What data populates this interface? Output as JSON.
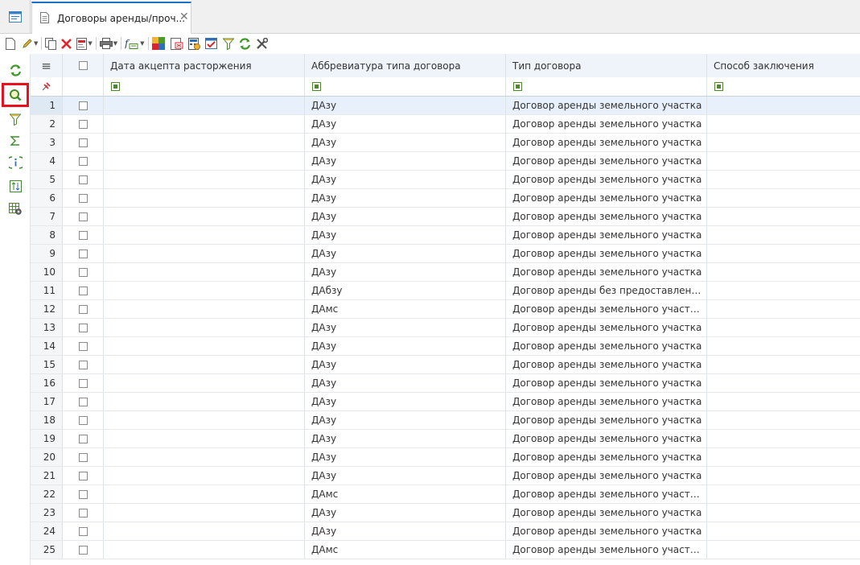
{
  "tab": {
    "title": "Договоры аренды/проч...",
    "close": "✕"
  },
  "toolbar": {
    "icons": [
      "new-document-icon",
      "edit-pencil-icon",
      "copy-icon",
      "delete-icon",
      "report-icon",
      "print-icon",
      "formula-icon",
      "transfer-icon",
      "export-icon",
      "calculator-icon",
      "checklist-icon",
      "filter-icon",
      "refresh-icon",
      "tools-icon"
    ]
  },
  "left_toolbar": {
    "items": [
      "refresh-icon",
      "search-icon",
      "filter-icon",
      "sum-icon",
      "info-icon",
      "sort-icon",
      "grid-settings-icon"
    ],
    "selected": "search-icon"
  },
  "grid": {
    "columns": [
      {
        "label": "Дата акцепта расторжения"
      },
      {
        "label": "Аббревиатура типа договора"
      },
      {
        "label": "Тип договора"
      },
      {
        "label": "Способ заключения"
      }
    ],
    "menu_glyph": "≡",
    "rows": [
      {
        "n": "1",
        "abbr": "ДАзу",
        "type": "Договор аренды земельного участка"
      },
      {
        "n": "2",
        "abbr": "ДАзу",
        "type": "Договор аренды земельного участка"
      },
      {
        "n": "3",
        "abbr": "ДАзу",
        "type": "Договор аренды земельного участка"
      },
      {
        "n": "4",
        "abbr": "ДАзу",
        "type": "Договор аренды земельного участка"
      },
      {
        "n": "5",
        "abbr": "ДАзу",
        "type": "Договор аренды земельного участка"
      },
      {
        "n": "6",
        "abbr": "ДАзу",
        "type": "Договор аренды земельного участка"
      },
      {
        "n": "7",
        "abbr": "ДАзу",
        "type": "Договор аренды земельного участка"
      },
      {
        "n": "8",
        "abbr": "ДАзу",
        "type": "Договор аренды земельного участка"
      },
      {
        "n": "9",
        "abbr": "ДАзу",
        "type": "Договор аренды земельного участка"
      },
      {
        "n": "10",
        "abbr": "ДАзу",
        "type": "Договор аренды земельного участка"
      },
      {
        "n": "11",
        "abbr": "ДАбзу",
        "type": "Договор аренды без предоставлени..."
      },
      {
        "n": "12",
        "abbr": "ДАмс",
        "type": "Договор аренды земельного участк..."
      },
      {
        "n": "13",
        "abbr": "ДАзу",
        "type": "Договор аренды земельного участка"
      },
      {
        "n": "14",
        "abbr": "ДАзу",
        "type": "Договор аренды земельного участка"
      },
      {
        "n": "15",
        "abbr": "ДАзу",
        "type": "Договор аренды земельного участка"
      },
      {
        "n": "16",
        "abbr": "ДАзу",
        "type": "Договор аренды земельного участка"
      },
      {
        "n": "17",
        "abbr": "ДАзу",
        "type": "Договор аренды земельного участка"
      },
      {
        "n": "18",
        "abbr": "ДАзу",
        "type": "Договор аренды земельного участка"
      },
      {
        "n": "19",
        "abbr": "ДАзу",
        "type": "Договор аренды земельного участка"
      },
      {
        "n": "20",
        "abbr": "ДАзу",
        "type": "Договор аренды земельного участка"
      },
      {
        "n": "21",
        "abbr": "ДАзу",
        "type": "Договор аренды земельного участка"
      },
      {
        "n": "22",
        "abbr": "ДАмс",
        "type": "Договор аренды земельного участк..."
      },
      {
        "n": "23",
        "abbr": "ДАзу",
        "type": "Договор аренды земельного участка"
      },
      {
        "n": "24",
        "abbr": "ДАзу",
        "type": "Договор аренды земельного участка"
      },
      {
        "n": "25",
        "abbr": "ДАмс",
        "type": "Договор аренды земельного участк..."
      }
    ]
  }
}
